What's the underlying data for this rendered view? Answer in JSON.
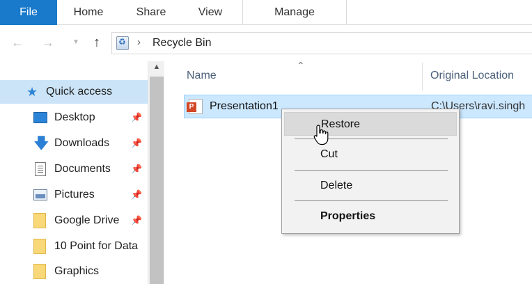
{
  "ribbon": {
    "tabs": [
      "File",
      "Home",
      "Share",
      "View",
      "Manage"
    ]
  },
  "navbar": {
    "back_icon": "arrow-left-icon",
    "forward_icon": "arrow-right-icon",
    "up_icon": "arrow-up-icon",
    "address": "Recycle Bin"
  },
  "navpane": {
    "items": [
      {
        "label": "Quick access",
        "icon": "star-icon",
        "pinned": false,
        "selected": true
      },
      {
        "label": "Desktop",
        "icon": "desktop-icon",
        "pinned": true
      },
      {
        "label": "Downloads",
        "icon": "downloads-icon",
        "pinned": true
      },
      {
        "label": "Documents",
        "icon": "documents-icon",
        "pinned": true
      },
      {
        "label": "Pictures",
        "icon": "pictures-icon",
        "pinned": true
      },
      {
        "label": "Google Drive",
        "icon": "folder-icon",
        "pinned": true
      },
      {
        "label": "10 Point for Data",
        "icon": "folder-icon",
        "pinned": false
      },
      {
        "label": "Graphics",
        "icon": "folder-icon",
        "pinned": false
      }
    ]
  },
  "content": {
    "columns": {
      "name": "Name",
      "original_location": "Original Location"
    },
    "files": [
      {
        "name": "Presentation1",
        "original_location": "C:\\Users\\ravi.singh"
      }
    ]
  },
  "context_menu": {
    "items": [
      "Restore",
      "Cut",
      "Delete",
      "Properties"
    ]
  },
  "colors": {
    "file_tab": "#1979ca",
    "selection": "#cce8ff",
    "nav_selected": "#cce4f7"
  }
}
